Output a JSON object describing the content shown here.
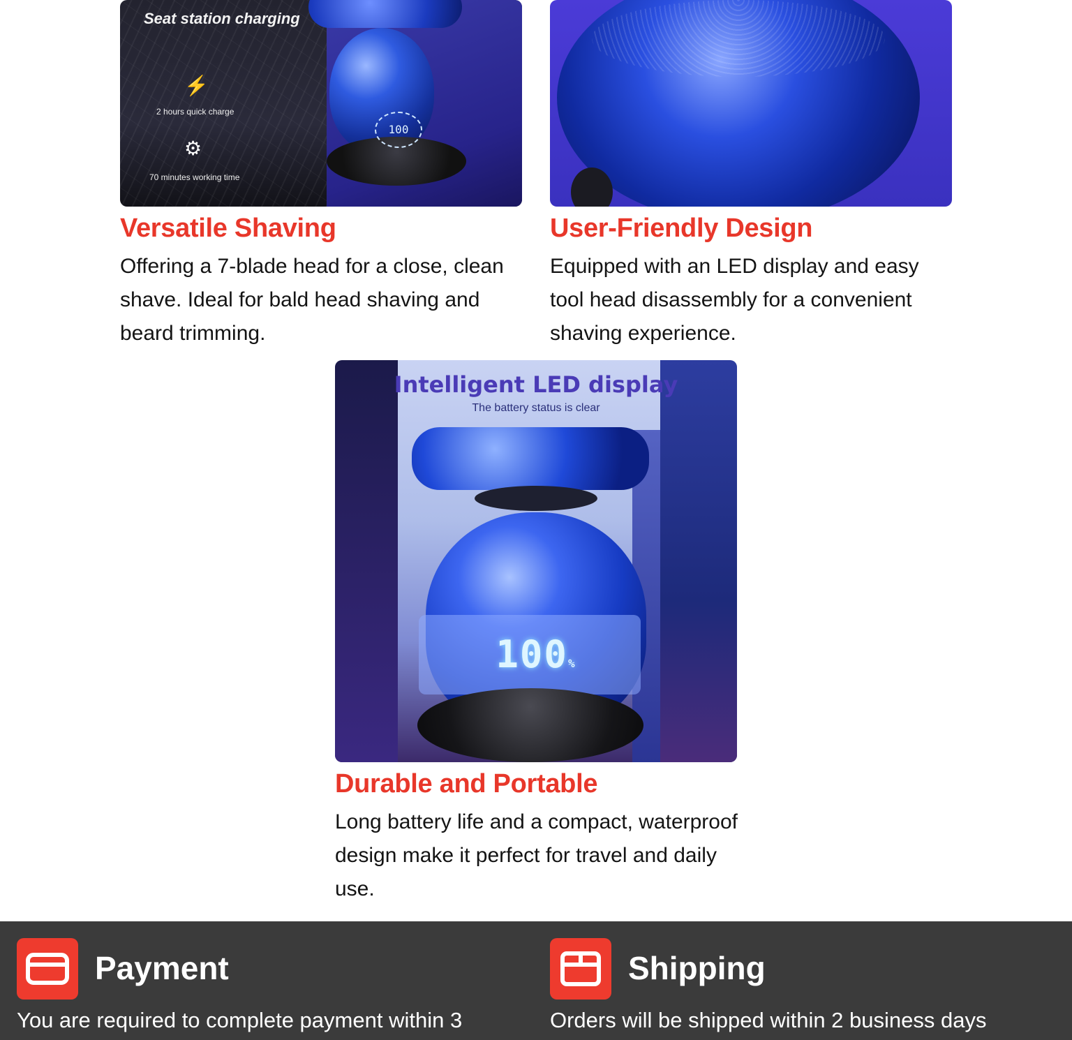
{
  "features": [
    {
      "title": "Versatile Shaving",
      "description": "Offering a 7-blade head for a close, clean shave. Ideal for bald head shaving and beard trimming.",
      "image": {
        "heading": "Seat station charging",
        "points": [
          "2 hours quick charge",
          "70 minutes working time"
        ],
        "display": "100"
      }
    },
    {
      "title": "User-Friendly Design",
      "description": "Equipped with an LED display and easy tool head disassembly for a convenient shaving experience."
    },
    {
      "title": "Durable and Portable",
      "description": "Long battery life and a compact, waterproof design make it perfect for travel and daily use.",
      "image": {
        "heading": "Intelligent LED display",
        "subheading": "The battery status is clear",
        "display": "100",
        "unit": "%"
      }
    }
  ],
  "info": {
    "payment": {
      "title": "Payment",
      "text": "You are required to complete payment within 3",
      "icon": "credit-card-icon"
    },
    "shipping": {
      "title": "Shipping",
      "text": "Orders will be shipped within 2 business days",
      "icon": "package-box-icon"
    }
  },
  "colors": {
    "accent": "#e8372a",
    "bar_bg": "#3b3b3b",
    "icon_bg": "#ee3b2e"
  }
}
